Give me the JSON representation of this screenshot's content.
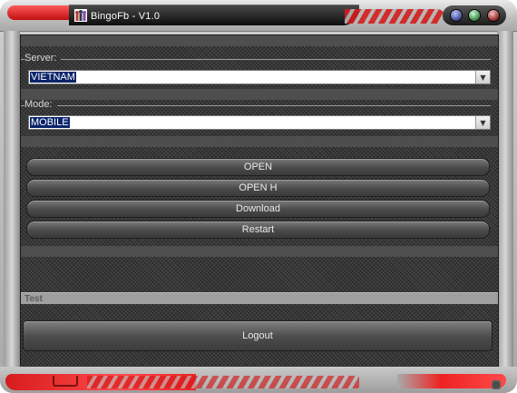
{
  "window": {
    "title": "BingoFb - V1.0",
    "accent_color": "#d41b1b"
  },
  "server": {
    "label": "Server:",
    "selected": "VIETNAM"
  },
  "mode": {
    "label": "Mode:",
    "selected": "MOBILE"
  },
  "buttons": {
    "open": "OPEN",
    "open_h": "OPEN H",
    "download": "Download",
    "restart": "Restart",
    "logout": "Logout"
  },
  "status": {
    "text": "Test"
  }
}
